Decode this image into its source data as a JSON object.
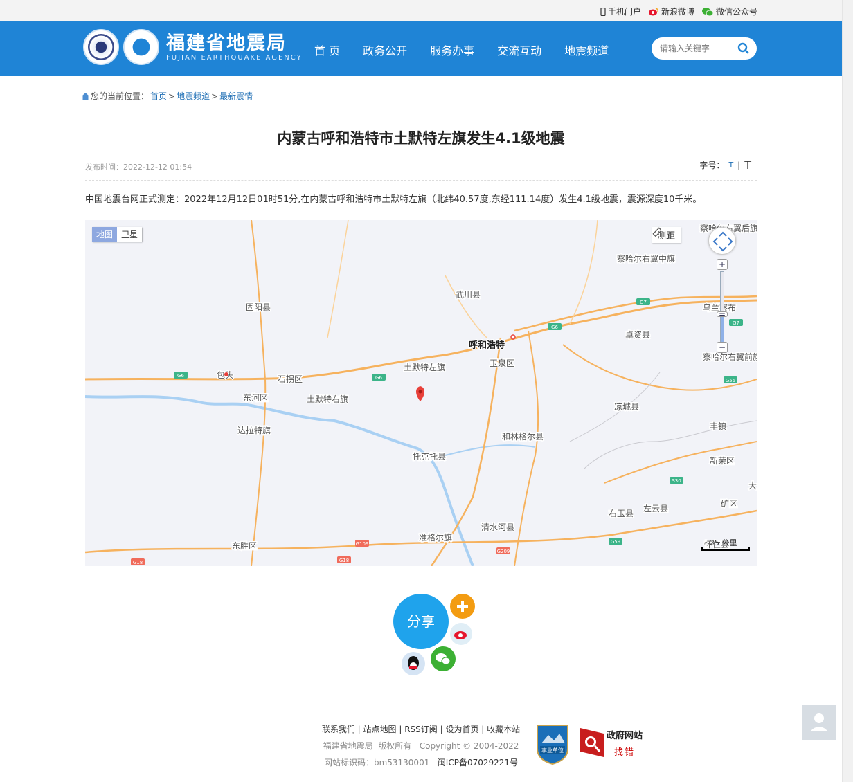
{
  "topbar": {
    "links": [
      {
        "label": "手机门户",
        "icon": "mobile-icon"
      },
      {
        "label": "新浪微博",
        "icon": "weibo-icon"
      },
      {
        "label": "微信公众号",
        "icon": "wechat-icon"
      }
    ]
  },
  "header": {
    "site_name": "福建省地震局",
    "site_name_en": "FUJIAN EARTHQUAKE AGENCY",
    "nav": [
      "首 页",
      "政务公开",
      "服务办事",
      "交流互动",
      "地震频道"
    ],
    "search_placeholder": "请输入关键字"
  },
  "breadcrumb": {
    "prefix": "您的当前位置：",
    "items": [
      "首页",
      "地震频道",
      "最新震情"
    ],
    "separator": ">"
  },
  "article": {
    "title": "内蒙古呼和浩特市土默特左旗发生4.1级地震",
    "publish_label": "发布时间：",
    "publish_time": "2022-12-12 01:54",
    "fontsize_label": "字号：",
    "fontsize_small": "T",
    "fontsize_large": "T",
    "body": "中国地震台网正式测定：2022年12月12日01时51分,在内蒙古呼和浩特市土默特左旗（北纬40.57度,东经111.14度）发生4.1级地震，震源深度10千米。"
  },
  "map": {
    "type_options": [
      "地图",
      "卫星"
    ],
    "type_selected": "地图",
    "ruler_label": "测距",
    "scale_label": "25 公里",
    "places": [
      {
        "name": "察哈尔右翼后旗"
      },
      {
        "name": "察哈尔右翼中旗"
      },
      {
        "name": "武川县"
      },
      {
        "name": "固阳县"
      },
      {
        "name": "乌兰察布"
      },
      {
        "name": "卓资县"
      },
      {
        "name": "呼和浩特"
      },
      {
        "name": "玉泉区"
      },
      {
        "name": "土默特左旗"
      },
      {
        "name": "包头"
      },
      {
        "name": "石拐区"
      },
      {
        "name": "察哈尔右翼前旗"
      },
      {
        "name": "东河区"
      },
      {
        "name": "土默特右旗"
      },
      {
        "name": "凉城县"
      },
      {
        "name": "达拉特旗"
      },
      {
        "name": "和林格尔县"
      },
      {
        "name": "丰镇"
      },
      {
        "name": "托克托县"
      },
      {
        "name": "新荣区"
      },
      {
        "name": "大"
      },
      {
        "name": "右玉县"
      },
      {
        "name": "左云县"
      },
      {
        "name": "矿区"
      },
      {
        "name": "清水河县"
      },
      {
        "name": "准格尔旗"
      },
      {
        "name": "东胜区"
      },
      {
        "name": "怀仁县"
      }
    ],
    "road_labels": [
      "G7",
      "G6",
      "G6",
      "G6",
      "G7",
      "G55",
      "S30",
      "G59",
      "G109",
      "G18",
      "G18",
      "G209"
    ]
  },
  "share": {
    "label": "分享"
  },
  "footer": {
    "links": [
      "联系我们",
      "站点地图",
      "RSS订阅",
      "设为首页",
      "收藏本站"
    ],
    "copyright_owner": "福建省地震局",
    "copyright_rights": "版权所有",
    "copyright_years": "Copyright © 2004-2022",
    "site_id": "网站标识码：bm53130001",
    "icp": "闽ICP备07029221号",
    "badge1_label": "事业单位",
    "badge2_line1": "政府网站",
    "badge2_line2": "找错"
  },
  "colors": {
    "header_blue": "#1f84d6",
    "link_blue": "#1f6fb5",
    "share_blue": "#1fa3ec",
    "marker_red": "#e8403a",
    "road_orange": "#f6b25e",
    "river_blue": "#a9d0f3"
  }
}
